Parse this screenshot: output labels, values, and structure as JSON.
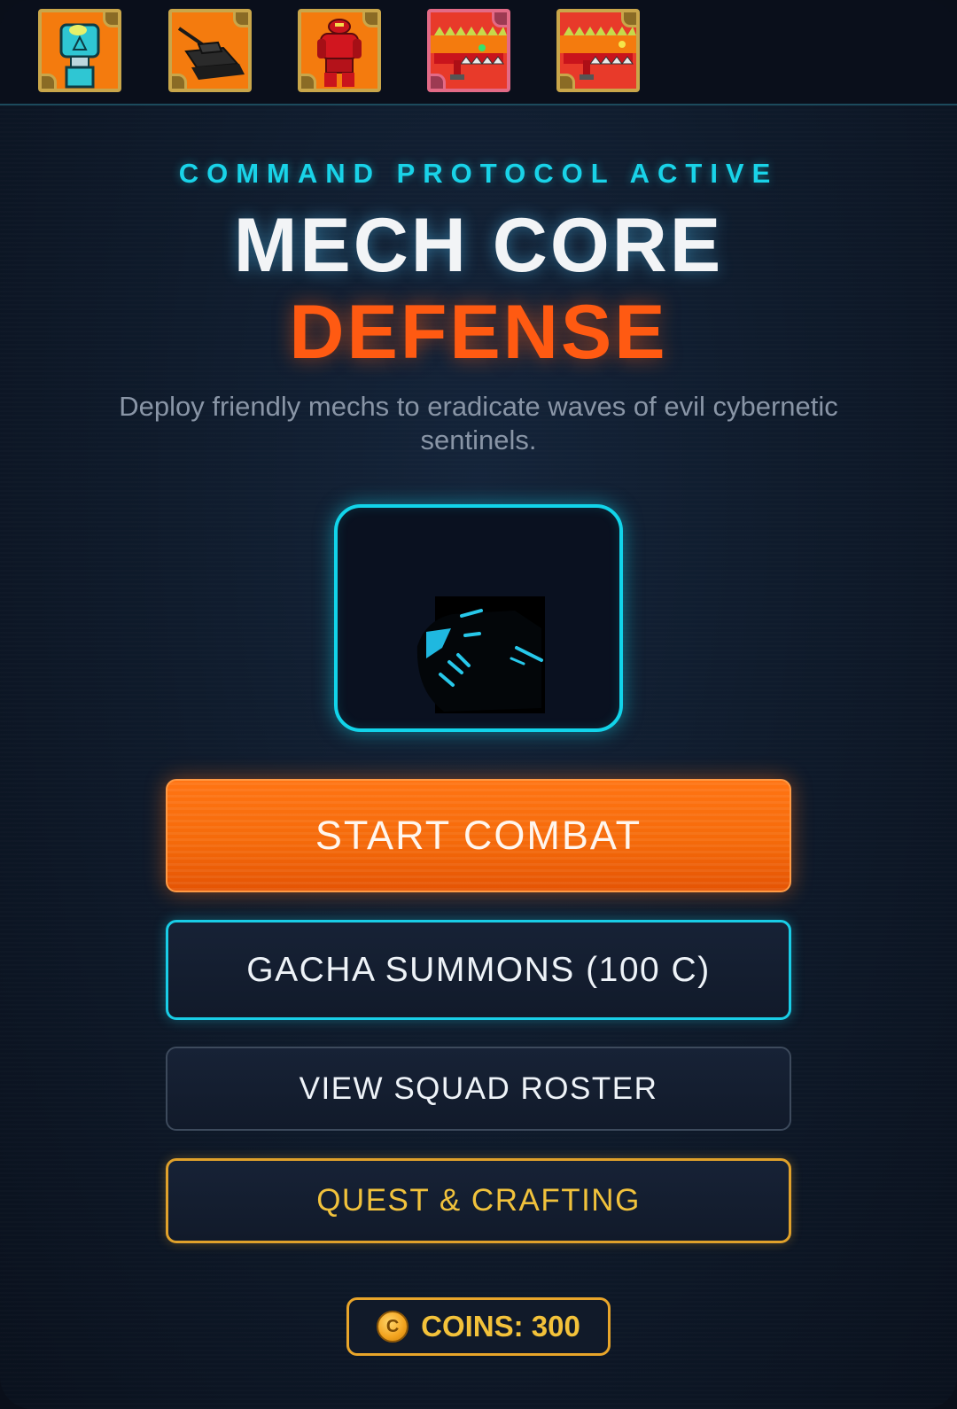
{
  "game": {
    "eyebrow": "COMMAND PROTOCOL ACTIVE",
    "title_line1": "MECH CORE",
    "title_line2": "DEFENSE",
    "subtitle": "Deploy friendly mechs to eradicate waves of evil cybernetic sentinels."
  },
  "unit_bar": {
    "units": [
      {
        "name": "cyan-mech-unit",
        "selected": false
      },
      {
        "name": "tank-unit",
        "selected": false
      },
      {
        "name": "red-brute-unit",
        "selected": false
      },
      {
        "name": "red-chomper-unit",
        "selected": true
      },
      {
        "name": "red-chomper-unit-2",
        "selected": false
      }
    ]
  },
  "menu": {
    "start_label": "START COMBAT",
    "gacha_label": "GACHA SUMMONS (100 C)",
    "roster_label": "VIEW SQUAD ROSTER",
    "quest_label": "QUEST & CRAFTING"
  },
  "wallet": {
    "coin_symbol": "C",
    "coins_label": "COINS: 300"
  },
  "colors": {
    "accent_cyan": "#19d3e8",
    "accent_orange": "#ff5a12",
    "accent_gold": "#f1c23c",
    "background": "#0f1b2c"
  }
}
